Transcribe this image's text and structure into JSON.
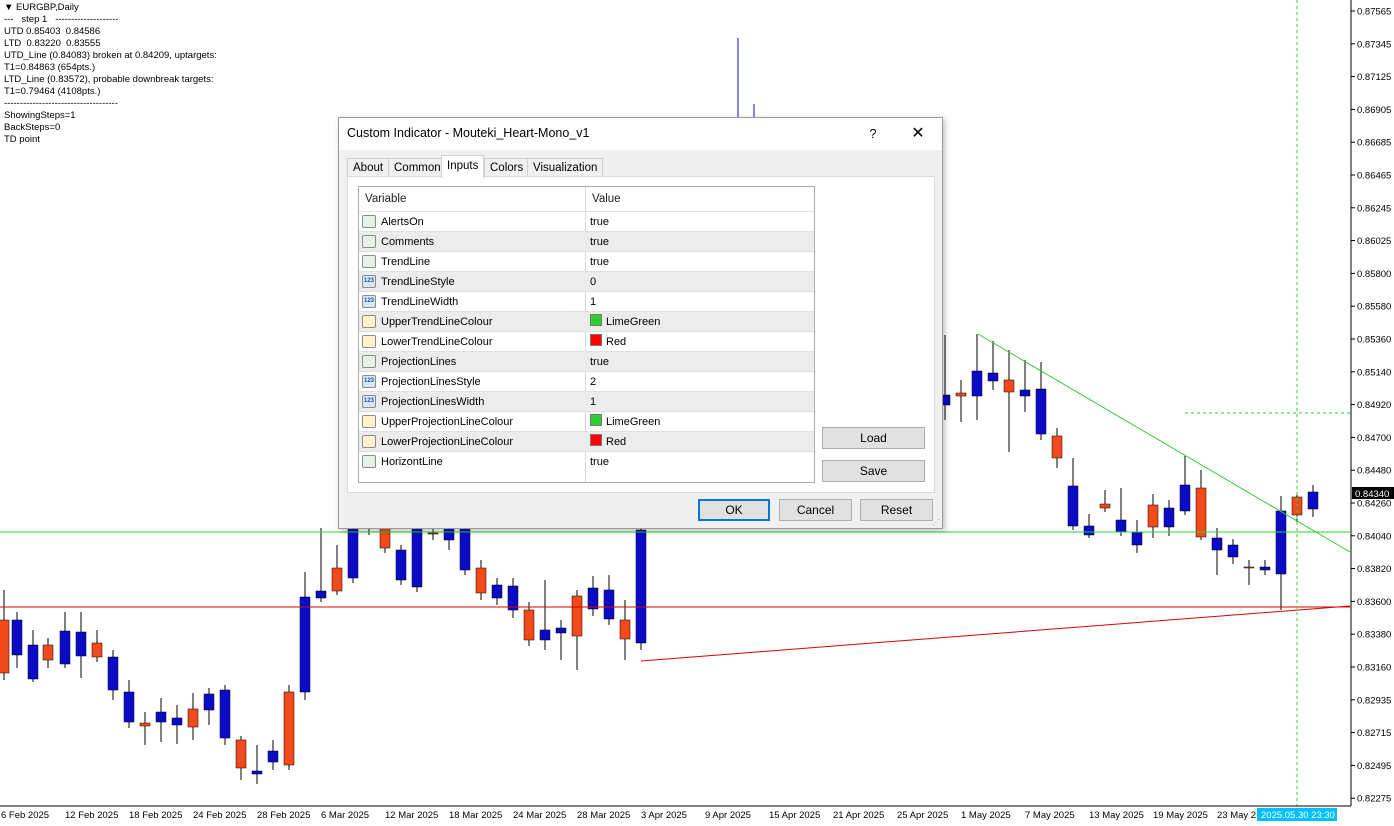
{
  "chart": {
    "symbol_title": "EURGBP,Daily",
    "info_lines": [
      "---   step 1   --------------------",
      "UTD 0.85403  0.84586",
      "LTD  0.83220  0.83555",
      "UTD_Line (0.84083) broken at 0.84209, uptargets:",
      "T1=0.84863 (654pts.)",
      "LTD_Line (0.83572), probable downbreak targets:",
      "T1=0.79464 (4108pts.)",
      "------------------------------------",
      "ShowingSteps=1",
      "BackSteps=0",
      "TD point"
    ],
    "price_labels": [
      "0.87565",
      "0.87345",
      "0.87125",
      "0.86905",
      "0.86685",
      "0.86465",
      "0.86245",
      "0.86025",
      "0.85800",
      "0.85580",
      "0.85360",
      "0.85140",
      "0.84920",
      "0.84700",
      "0.84480",
      "0.84260",
      "0.84040",
      "0.83820",
      "0.83600",
      "0.83380",
      "0.83160",
      "0.82935",
      "0.82715",
      "0.82495",
      "0.82275"
    ],
    "current_price": "0.84340",
    "date_labels": [
      "6 Feb 2025",
      "12 Feb 2025",
      "18 Feb 2025",
      "24 Feb 2025",
      "28 Feb 2025",
      "6 Mar 2025",
      "12 Mar 2025",
      "18 Mar 2025",
      "24 Mar 2025",
      "28 Mar 2025",
      "3 Apr 2025",
      "9 Apr 2025",
      "15 Apr 2025",
      "21 Apr 2025",
      "25 Apr 2025",
      "1 May 2025",
      "7 May 2025",
      "13 May 2025",
      "19 May 2025",
      "23 May 2"
    ],
    "cursor_time": "2025.05.30 23:30",
    "colors": {
      "bull": "#f24a1a",
      "bear": "#0a0ac8",
      "upper_line": "#32cd32",
      "lower_line": "#e00000"
    }
  },
  "dialog": {
    "title": "Custom Indicator - Mouteki_Heart-Mono_v1",
    "help_label": "?",
    "close_label": "✕",
    "tabs": [
      {
        "label": "About",
        "active": false
      },
      {
        "label": "Common",
        "active": false
      },
      {
        "label": "Inputs",
        "active": true
      },
      {
        "label": "Colors",
        "active": false
      },
      {
        "label": "Visualization",
        "active": false
      }
    ],
    "columns": {
      "variable": "Variable",
      "value": "Value"
    },
    "inputs": [
      {
        "type": "bool",
        "name": "AlertsOn",
        "value": "true"
      },
      {
        "type": "bool",
        "name": "Comments",
        "value": "true"
      },
      {
        "type": "bool",
        "name": "TrendLine",
        "value": "true"
      },
      {
        "type": "int",
        "name": "TrendLineStyle",
        "value": "0"
      },
      {
        "type": "int",
        "name": "TrendLineWidth",
        "value": "1"
      },
      {
        "type": "color",
        "name": "UpperTrendLineColour",
        "value": "LimeGreen",
        "swatch": "#32cd32"
      },
      {
        "type": "color",
        "name": "LowerTrendLineColour",
        "value": "Red",
        "swatch": "#ff0000"
      },
      {
        "type": "bool",
        "name": "ProjectionLines",
        "value": "true"
      },
      {
        "type": "int",
        "name": "ProjectionLinesStyle",
        "value": "2"
      },
      {
        "type": "int",
        "name": "ProjectionLinesWidth",
        "value": "1"
      },
      {
        "type": "color",
        "name": "UpperProjectionLineColour",
        "value": "LimeGreen",
        "swatch": "#32cd32"
      },
      {
        "type": "color",
        "name": "LowerProjectionLineColour",
        "value": "Red",
        "swatch": "#ff0000"
      },
      {
        "type": "bool",
        "name": "HorizontLine",
        "value": "true"
      }
    ],
    "side_buttons": {
      "load": "Load",
      "save": "Save"
    },
    "footer_buttons": {
      "ok": "OK",
      "cancel": "Cancel",
      "reset": "Reset"
    }
  }
}
